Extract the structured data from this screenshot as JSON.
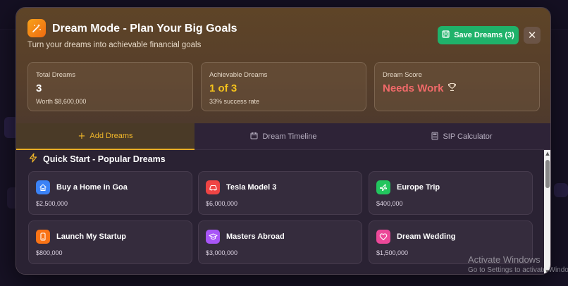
{
  "modal": {
    "title": "Dream Mode - Plan Your Big Goals",
    "subtitle": "Turn your dreams into achievable financial goals",
    "save_button": "Save Dreams (3)",
    "close_symbol": "✕"
  },
  "stats": [
    {
      "label": "Total Dreams",
      "value": "3",
      "sub": "Worth $8,600,000",
      "color": "#ffffff"
    },
    {
      "label": "Achievable Dreams",
      "value": "1 of 3",
      "sub": "33% success rate",
      "color": "#f5c21b"
    },
    {
      "label": "Dream Score",
      "value": "Needs Work",
      "sub": "",
      "color": "#f26a6a",
      "icon": "trophy-icon"
    }
  ],
  "tabs": [
    {
      "label": "Add Dreams",
      "icon": "plus-icon",
      "active": true
    },
    {
      "label": "Dream Timeline",
      "icon": "calendar-icon",
      "active": false
    },
    {
      "label": "SIP Calculator",
      "icon": "calculator-icon",
      "active": false
    }
  ],
  "quick_start": {
    "title": "Quick Start - Popular Dreams",
    "icon": "lightning-icon",
    "items": [
      {
        "name": "Buy a Home in Goa",
        "amount": "$2,500,000",
        "icon": "home-icon",
        "color": "#3b82f6"
      },
      {
        "name": "Tesla Model 3",
        "amount": "$6,000,000",
        "icon": "car-icon",
        "color": "#ef4444"
      },
      {
        "name": "Europe Trip",
        "amount": "$400,000",
        "icon": "plane-icon",
        "color": "#22c55e"
      },
      {
        "name": "Launch My Startup",
        "amount": "$800,000",
        "icon": "phone-icon",
        "color": "#f97316"
      },
      {
        "name": "Masters Abroad",
        "amount": "$3,000,000",
        "icon": "graduation-cap-icon",
        "color": "#a855f7"
      },
      {
        "name": "Dream Wedding",
        "amount": "$1,500,000",
        "icon": "heart-icon",
        "color": "#ec4899"
      }
    ]
  },
  "watermark": {
    "title": "Activate Windows",
    "subtitle": "Go to Settings to activate Windows."
  },
  "colors": {
    "accent": "#e9ad25",
    "save": "#1fb26a"
  }
}
